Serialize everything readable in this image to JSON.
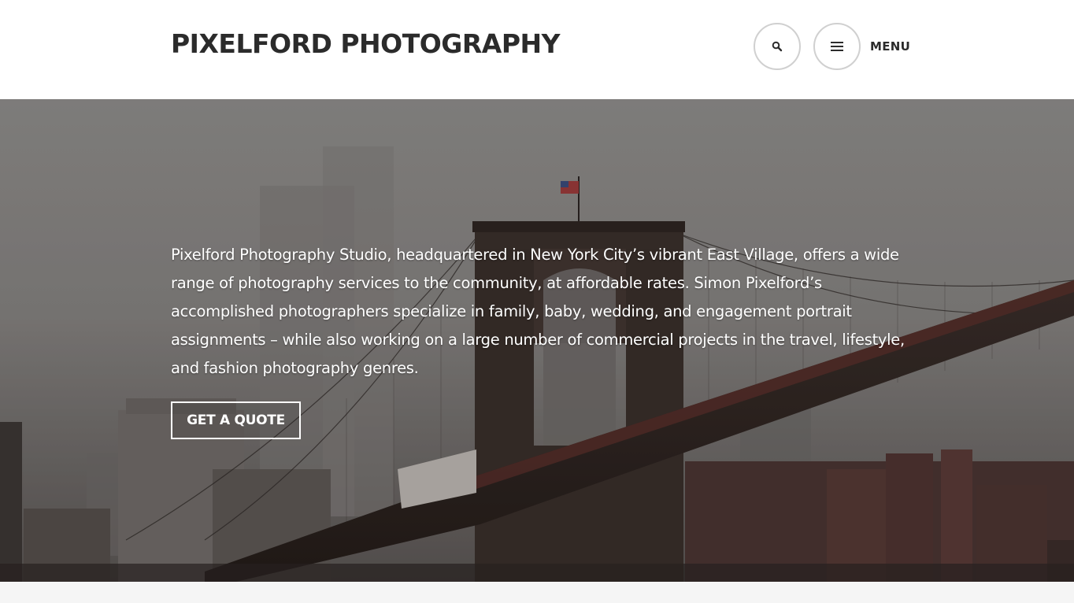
{
  "header": {
    "site_title": "PIXELFORD PHOTOGRAPHY",
    "menu_label": "MENU"
  },
  "hero": {
    "description": "Pixelford Photography Studio, headquartered in New York City’s vibrant East Village, offers a wide range of photography services to the community, at affordable rates. Simon Pixelford’s accomplished photographers specialize in family, baby, wedding, and engagement portrait assignments – while also working on a large number of commercial projects in the travel, lifestyle, and fashion photography genres.",
    "cta_label": "GET A QUOTE"
  },
  "icons": {
    "search": "search-icon",
    "menu": "hamburger-icon"
  },
  "colors": {
    "title": "#2b2b2b",
    "button_border": "#d0d0d0",
    "hero_text": "#ffffff"
  }
}
